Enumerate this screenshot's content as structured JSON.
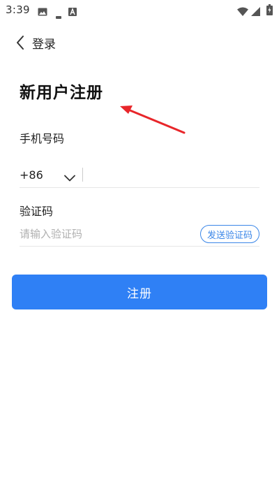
{
  "status_bar": {
    "time": "3:39",
    "icons": [
      "image-icon",
      "minus-icon",
      "a-icon",
      "wifi-icon",
      "signal-icon",
      "battery-icon"
    ]
  },
  "nav": {
    "back_label": "登录",
    "back_icon": "chevron-left-icon"
  },
  "page": {
    "title": "新用户注册"
  },
  "phone": {
    "label": "手机号码",
    "country_code": "+86",
    "value": ""
  },
  "code": {
    "label": "验证码",
    "placeholder": "请输入验证码",
    "value": "",
    "send_button_label": "发送验证码"
  },
  "register_button_label": "注册",
  "colors": {
    "primary": "#2f80f5",
    "send_button_border": "#3a86e8",
    "annotation_arrow": "#e8262a"
  }
}
